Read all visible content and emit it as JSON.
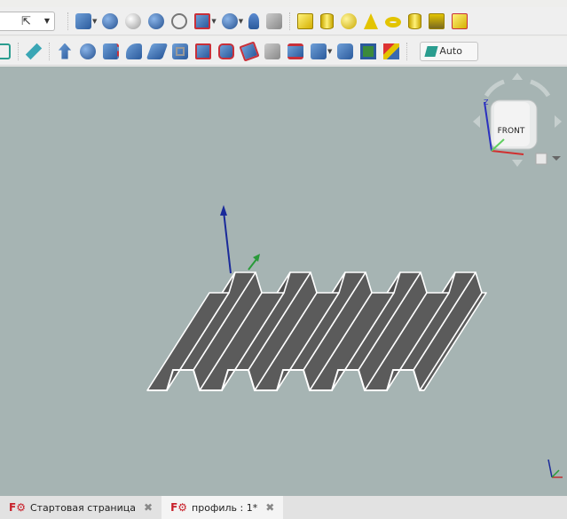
{
  "toolbar": {
    "auto_label": "Auto",
    "icons_row1": [
      "view-cube-icon",
      "union-icon",
      "cut-icon",
      "fuse-icon",
      "intersect-icon",
      "join-icon",
      "boolean-icon",
      "primitive-icon",
      "shape-builder-icon",
      "box-icon",
      "cylinder-icon",
      "sphere-icon",
      "cone-icon",
      "torus-icon",
      "tube-icon",
      "primitives-icon",
      "shape-builder-part-icon"
    ],
    "icons_row2": [
      "wireframe-icon",
      "measure-icon",
      "extrude-icon",
      "revolve-icon",
      "mirror-icon",
      "fillet-icon",
      "chamfer-icon",
      "make-face-icon",
      "ruled-surface-icon",
      "loft-icon",
      "sweep-icon",
      "section-icon",
      "cross-sections-icon",
      "offset-icon",
      "thickness-icon",
      "projection-icon",
      "color-per-face-icon"
    ]
  },
  "navcube": {
    "face_label": "FRONT",
    "axis_z": "Z"
  },
  "tabs": [
    {
      "label": "Стартовая страница",
      "active": false
    },
    {
      "label": "профиль : 1*",
      "active": true
    }
  ],
  "colors": {
    "viewport": "#a6b4b3",
    "shape": "#5b5b5b",
    "edge": "#ffffff"
  }
}
